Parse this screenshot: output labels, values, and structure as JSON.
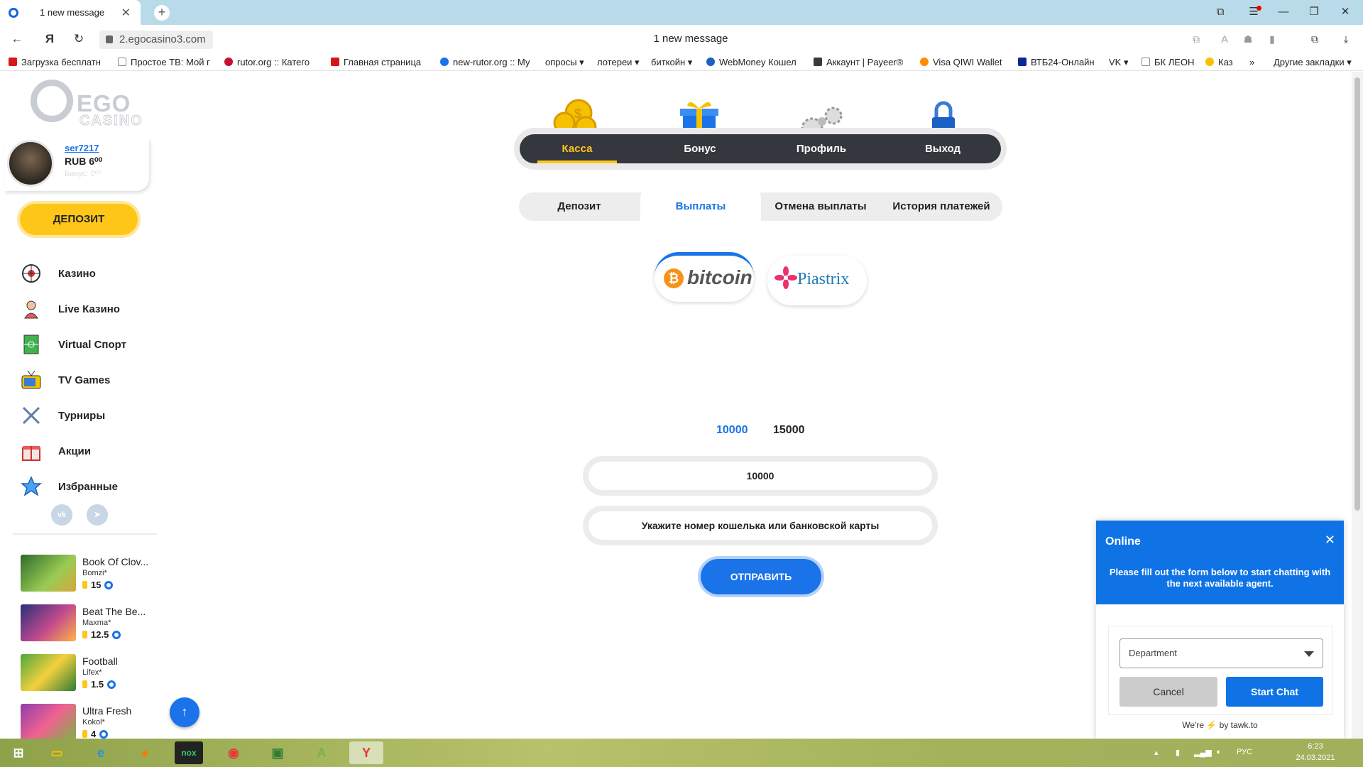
{
  "browser": {
    "tab_title": "1 new message",
    "url": "2.egocasino3.com",
    "page_title": "1 new message",
    "bookmarks": [
      {
        "label": "Загрузка бесплатн",
        "icon": "adobe-icon",
        "color": "#d4171b"
      },
      {
        "label": "Простое ТВ: Мой г",
        "icon": "page-icon",
        "color": "#888888"
      },
      {
        "label": "rutor.org :: Катего",
        "icon": "rutor-icon",
        "color": "#c8102e"
      },
      {
        "label": "Главная страница",
        "icon": "page-icon",
        "color": "#d4171b"
      },
      {
        "label": "new-rutor.org :: Му",
        "icon": "rutor-icon",
        "color": "#1a73e8"
      },
      {
        "label": "опросы ▾",
        "icon": "",
        "color": ""
      },
      {
        "label": "лотереи ▾",
        "icon": "",
        "color": ""
      },
      {
        "label": "биткойн ▾",
        "icon": "",
        "color": ""
      },
      {
        "label": "WebMoney Кошел",
        "icon": "webmoney-icon",
        "color": "#1f5fbf"
      },
      {
        "label": "Аккаунт | Payeer®",
        "icon": "payeer-icon",
        "color": "#3a3a3a"
      },
      {
        "label": "Visa QIWI Wallet",
        "icon": "qiwi-icon",
        "color": "#ff8c00"
      },
      {
        "label": "ВТБ24-Онлайн",
        "icon": "vtb-icon",
        "color": "#0a2896"
      },
      {
        "label": "VK ▾",
        "icon": "",
        "color": ""
      },
      {
        "label": "БК ЛЕОН",
        "icon": "page-icon",
        "color": "#888888"
      },
      {
        "label": "Каз",
        "icon": "star-icon",
        "color": "#f6c100"
      },
      {
        "label": "»",
        "icon": "",
        "color": ""
      },
      {
        "label": "Другие закладки ▾",
        "icon": "",
        "color": ""
      }
    ]
  },
  "sidebar": {
    "logo_top": "EGO",
    "logo_bottom": "CASINO",
    "user": {
      "name": "ser7217",
      "balance": "RUB 6⁰⁰",
      "bonus": "Бонус: 0⁰⁰"
    },
    "deposit_label": "ДЕПОЗИТ",
    "menu": [
      {
        "label": "Казино",
        "icon": "roulette-icon"
      },
      {
        "label": "Live Казино",
        "icon": "dealer-icon"
      },
      {
        "label": "Virtual Спорт",
        "icon": "sport-field-icon"
      },
      {
        "label": "TV Games",
        "icon": "tv-icon"
      },
      {
        "label": "Турниры",
        "icon": "swords-icon"
      },
      {
        "label": "Акции",
        "icon": "gift-icon"
      },
      {
        "label": "Избранные",
        "icon": "star-icon"
      }
    ],
    "social": [
      "vk-icon",
      "telegram-icon"
    ],
    "games": [
      {
        "name": "Book Of Clov...",
        "provider": "Bomzi*",
        "bet": "15"
      },
      {
        "name": "Beat The Be...",
        "provider": "Maxma*",
        "bet": "12.5"
      },
      {
        "name": "Football",
        "provider": "Lifex*",
        "bet": "1.5"
      },
      {
        "name": "Ultra Fresh",
        "provider": "Kokol*",
        "bet": "4"
      }
    ]
  },
  "topnav": {
    "items": [
      {
        "label": "Касса",
        "icon": "coins-icon",
        "active": true
      },
      {
        "label": "Бонус",
        "icon": "gift-box-icon",
        "active": false
      },
      {
        "label": "Профиль",
        "icon": "gears-icon",
        "active": false
      },
      {
        "label": "Выход",
        "icon": "padlock-icon",
        "active": false
      }
    ]
  },
  "subtabs": [
    {
      "label": "Депозит",
      "active": false
    },
    {
      "label": "Выплаты",
      "active": true
    },
    {
      "label": "Отмена выплаты",
      "active": false
    },
    {
      "label": "История платежей",
      "active": false
    }
  ],
  "payment_methods": [
    {
      "name": "bitcoin",
      "symbol": "₿",
      "active": true
    },
    {
      "name": "Piastrix",
      "active": false
    }
  ],
  "limits": {
    "min": "10000",
    "max": "15000"
  },
  "form": {
    "amount_value": "10000",
    "wallet_placeholder": "Укажите номер кошелька или банковской карты",
    "submit_label": "ОТПРАВИТЬ"
  },
  "chat": {
    "status": "Online",
    "message": "Please fill out the form below to start chatting with the next available agent.",
    "department_placeholder": "Department",
    "cancel_label": "Cancel",
    "start_label": "Start Chat",
    "footer_prefix": "We're",
    "footer_suffix": "by tawk.to"
  },
  "taskbar": {
    "apps": [
      "windows-start-icon",
      "file-explorer-icon",
      "ie-icon",
      "firefox-icon",
      "nox-icon",
      "chrome-icon",
      "store-icon",
      "android-icon",
      "yandex-browser-icon"
    ],
    "lang": "РУС",
    "time": "6:23",
    "date": "24.03.2021"
  },
  "colors": {
    "accent": "#1a73e8",
    "brand_yellow": "#ffc61a",
    "nav_dark": "#34373d",
    "chat_blue": "#0f73e6"
  }
}
